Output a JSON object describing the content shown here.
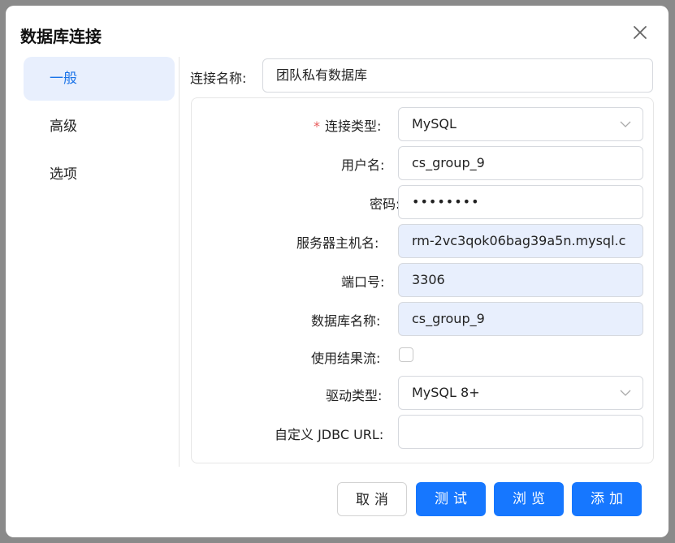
{
  "dialog": {
    "title": "数据库连接",
    "close_glyph": "✕"
  },
  "sidebar": {
    "items": [
      {
        "label": "一般",
        "active": true
      },
      {
        "label": "高级",
        "active": false
      },
      {
        "label": "选项",
        "active": false
      }
    ]
  },
  "form": {
    "connection_name": {
      "label": "连接名称:",
      "value": "团队私有数据库"
    },
    "connection_type": {
      "required_mark": "*",
      "label": "连接类型:",
      "value": "MySQL"
    },
    "username": {
      "label": "用户名:",
      "value": "cs_group_9"
    },
    "password": {
      "label": "密码:",
      "value": "••••••••"
    },
    "host": {
      "label": "服务器主机名:",
      "value": "rm-2vc3qok06bag39a5n.mysql.c"
    },
    "port": {
      "label": "端口号:",
      "value": "3306"
    },
    "database": {
      "label": "数据库名称:",
      "value": "cs_group_9"
    },
    "use_result_stream": {
      "label": "使用结果流:",
      "checked": false
    },
    "driver_type": {
      "label": "驱动类型:",
      "value": "MySQL 8+"
    },
    "custom_jdbc_url": {
      "label": "自定义 JDBC URL:",
      "value": ""
    }
  },
  "footer": {
    "cancel_label": "取消",
    "test_label": "测试",
    "browse_label": "浏览",
    "add_label": "添加"
  },
  "colors": {
    "accent": "#1677ff",
    "active_bg": "#e8effd",
    "required": "#e85b5b"
  }
}
